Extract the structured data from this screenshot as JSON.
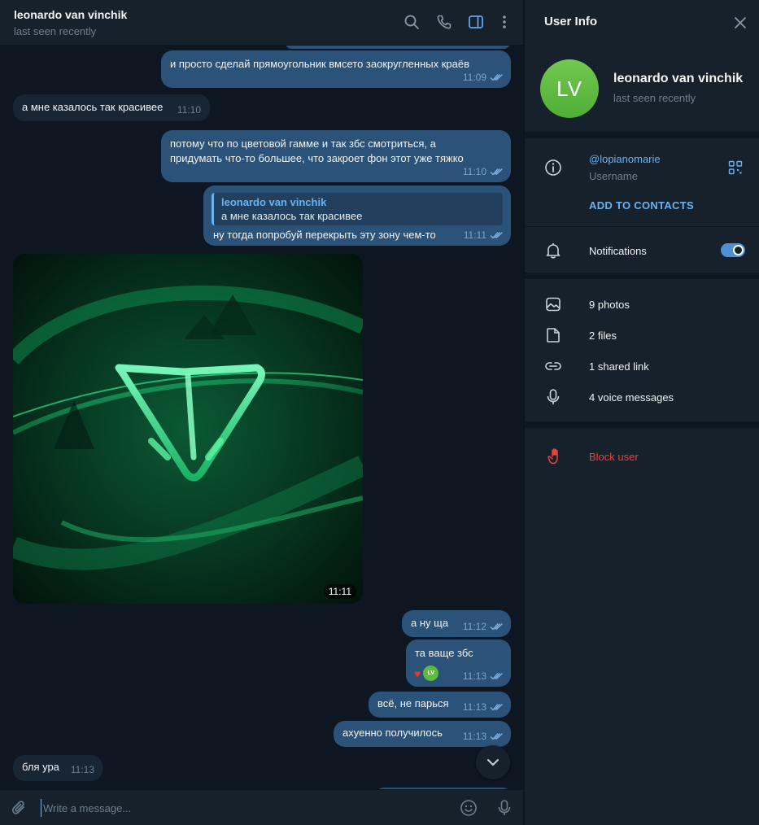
{
  "chat": {
    "title": "leonardo van vinchik",
    "status": "last seen recently",
    "composer_placeholder": "Write a message...",
    "messages": [
      {
        "dir": "out",
        "text": "и просто сделай прямоугольник вмсето заокругленных краёв",
        "time": "11:09"
      },
      {
        "dir": "in",
        "text": "а мне казалось так красивее",
        "time": "11:10"
      },
      {
        "dir": "out",
        "line1": "потому что по цветовой гамме и так збс смотриться, а",
        "line2": "придумать что-то большее, что закроет фон этот уже тяжко",
        "time": "11:10"
      },
      {
        "dir": "out",
        "reply_name": "leonardo van vinchik",
        "reply_text": "а мне казалось так красивее",
        "text": "ну тогда попробуй перекрыть эту зону чем-то",
        "time": "11:11"
      },
      {
        "dir": "in",
        "type": "photo",
        "time": "11:11"
      },
      {
        "dir": "out",
        "text": "а ну ща",
        "time": "11:12"
      },
      {
        "dir": "out",
        "text": "та ваще збс",
        "time": "11:13",
        "reaction_avatar": "LV"
      },
      {
        "dir": "out",
        "text": "всё, не парься",
        "time": "11:13"
      },
      {
        "dir": "out",
        "text": "ахуенно получилось",
        "time": "11:13"
      },
      {
        "dir": "in",
        "text": "бля ура",
        "time": "11:13"
      }
    ]
  },
  "panel": {
    "title": "User Info",
    "avatar_initials": "LV",
    "name": "leonardo van vinchik",
    "status": "last seen recently",
    "username": "@lopianomarie",
    "username_label": "Username",
    "add_contacts": "ADD TO CONTACTS",
    "notifications": "Notifications",
    "notifications_on": true,
    "media": {
      "photos": "9 photos",
      "files": "2 files",
      "links": "1 shared link",
      "voice": "4 voice messages"
    },
    "block": "Block user"
  },
  "colors": {
    "background": "#0e1621",
    "panel": "#17212b",
    "outgoing_bubble": "#2b5278",
    "incoming_bubble": "#182533",
    "accent": "#6ab2f2",
    "avatar": "#5dbb3d",
    "danger": "#e5443d"
  },
  "icons": [
    "search-icon",
    "phone-icon",
    "sidebar-toggle-icon",
    "more-vertical-icon",
    "close-icon",
    "info-icon",
    "qr-code-icon",
    "bell-icon",
    "image-icon",
    "file-icon",
    "link-icon",
    "microphone-icon",
    "hand-block-icon",
    "paperclip-icon",
    "emoji-icon",
    "chevron-down-icon",
    "double-check-icon",
    "heart-icon"
  ]
}
